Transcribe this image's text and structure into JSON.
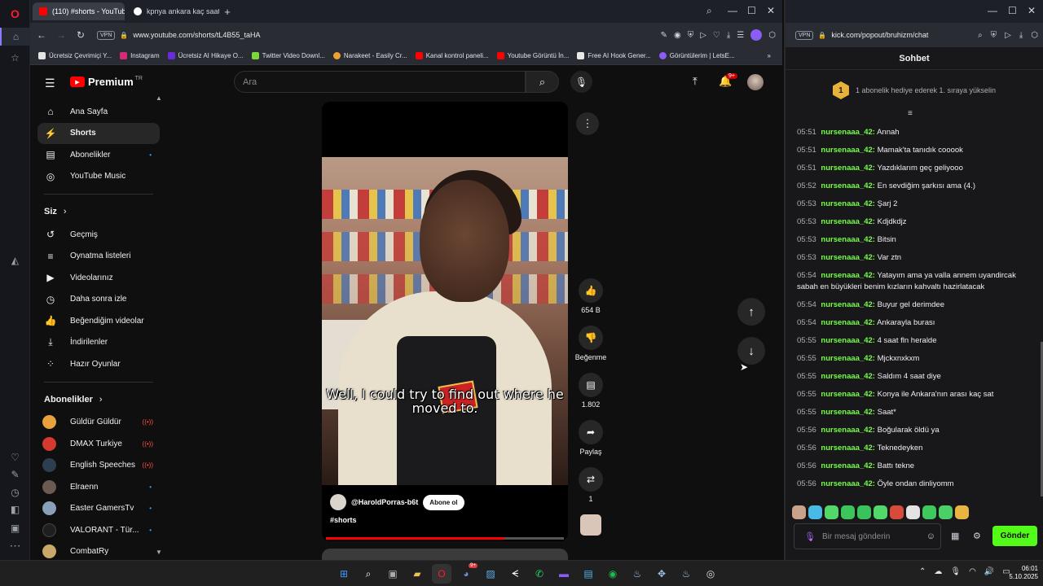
{
  "browser": {
    "tabs": [
      {
        "title": "(110) #shorts - YouTube",
        "active": true
      },
      {
        "title": "kpnya ankara kaç saat - G",
        "active": false
      }
    ],
    "url": "www.youtube.com/shorts/tL4B55_taHA",
    "vpn_label": "VPN",
    "bookmarks": [
      "Ücretsiz Çevrimiçi Y...",
      "Instagram",
      "Ücretsiz AI Hikaye O...",
      "Twitter Video Downl...",
      "Narakeet - Easily Cr...",
      "Kanal kontrol paneli...",
      "Youtube Görüntü İn...",
      "Free AI Hook Gener...",
      "Görüntülerim | LetsE..."
    ]
  },
  "youtube": {
    "logo": "Premium",
    "region": "TR",
    "search_placeholder": "Ara",
    "notif_count": "9+",
    "nav_main": [
      {
        "label": "Ana Sayfa",
        "icon": "home-icon"
      },
      {
        "label": "Shorts",
        "icon": "shorts-icon"
      },
      {
        "label": "Abonelikler",
        "icon": "subscriptions-icon"
      },
      {
        "label": "YouTube Music",
        "icon": "music-icon"
      }
    ],
    "you_title": "Siz",
    "nav_you": [
      {
        "label": "Geçmiş",
        "icon": "history-icon"
      },
      {
        "label": "Oynatma listeleri",
        "icon": "playlist-icon"
      },
      {
        "label": "Videolarınız",
        "icon": "video-icon"
      },
      {
        "label": "Daha sonra izle",
        "icon": "watch-later-icon"
      },
      {
        "label": "Beğendiğim videolar",
        "icon": "like-icon"
      },
      {
        "label": "İndirilenler",
        "icon": "download-icon"
      },
      {
        "label": "Hazır Oyunlar",
        "icon": "games-icon"
      }
    ],
    "subs_title": "Abonelikler",
    "subscriptions": [
      {
        "label": "Güldür Güldür",
        "status": "live",
        "color": "#e9a23b"
      },
      {
        "label": "DMAX Turkiye",
        "status": "live",
        "color": "#d43a2f"
      },
      {
        "label": "English Speeches",
        "status": "live",
        "color": "#2c3e50"
      },
      {
        "label": "Elraenn",
        "status": "new",
        "color": "#6b5a52"
      },
      {
        "label": "Easter GamersTv",
        "status": "new",
        "color": "#8aa0b8"
      },
      {
        "label": "VALORANT - Tür...",
        "status": "new",
        "color": "#1f1f1f"
      },
      {
        "label": "CombatRy",
        "status": "new",
        "color": "#c9a86a"
      }
    ],
    "short": {
      "subtitle": "Well, I could try to find out where he moved to.",
      "channel": "@HaroldPorras-b6t",
      "subscribe": "Abone ol",
      "hashtag": "#shorts",
      "progress": 0.75
    },
    "actions": {
      "likes": "654 B",
      "dislike": "Beğenme",
      "comments": "1.802",
      "share": "Paylaş",
      "remix": "1"
    }
  },
  "chat": {
    "url": "kick.com/popout/bruhizm/chat",
    "title": "Sohbet",
    "gift_rank": "1",
    "gift_text": "1 abonelik hediye ederek 1. sıraya yükselin",
    "messages": [
      {
        "time": "05:51",
        "user": "nursenaaa_42:",
        "text": "Annah"
      },
      {
        "time": "05:51",
        "user": "nursenaaa_42:",
        "text": "Mamak'ta tanıdık cooook"
      },
      {
        "time": "05:51",
        "user": "nursenaaa_42:",
        "text": "Yazdıklarım geç geliyooo"
      },
      {
        "time": "05:52",
        "user": "nursenaaa_42:",
        "text": "En sevdiğim şarkısı ama (4.)"
      },
      {
        "time": "05:53",
        "user": "nursenaaa_42:",
        "text": "Şarj 2"
      },
      {
        "time": "05:53",
        "user": "nursenaaa_42:",
        "text": "Kdjdkdjz"
      },
      {
        "time": "05:53",
        "user": "nursenaaa_42:",
        "text": "Bitsin"
      },
      {
        "time": "05:53",
        "user": "nursenaaa_42:",
        "text": "Var ztn"
      },
      {
        "time": "05:54",
        "user": "nursenaaa_42:",
        "text": "Yatayım ama ya valla annem uyandircak sabah en büyükleri benim kızların kahvaltı hazirlatacak"
      },
      {
        "time": "05:54",
        "user": "nursenaaa_42:",
        "text": "Buyur gel derimdee"
      },
      {
        "time": "05:54",
        "user": "nursenaaa_42:",
        "text": "Ankarayla burası"
      },
      {
        "time": "05:55",
        "user": "nursenaaa_42:",
        "text": "4 saat fln heralde"
      },
      {
        "time": "05:55",
        "user": "nursenaaa_42:",
        "text": "Mjckxnxkxm"
      },
      {
        "time": "05:55",
        "user": "nursenaaa_42:",
        "text": "Saldım 4 saat diye"
      },
      {
        "time": "05:55",
        "user": "nursenaaa_42:",
        "text": "Konya ile Ankara'nın arası kaç sat"
      },
      {
        "time": "05:55",
        "user": "nursenaaa_42:",
        "text": "Saat*"
      },
      {
        "time": "05:56",
        "user": "nursenaaa_42:",
        "text": "Boğularak öldü ya"
      },
      {
        "time": "05:56",
        "user": "nursenaaa_42:",
        "text": "Teknedeyken"
      },
      {
        "time": "05:56",
        "user": "nursenaaa_42:",
        "text": "Battı tekne"
      },
      {
        "time": "05:56",
        "user": "nursenaaa_42:",
        "text": "Öyle ondan dinliyomm"
      }
    ],
    "input_placeholder": "Bir mesaj gönderin",
    "send": "Gönder",
    "accent": "#53fc18"
  },
  "taskbar": {
    "time": "06:01",
    "date": "5.10.2025",
    "discord_badge": "9+"
  }
}
